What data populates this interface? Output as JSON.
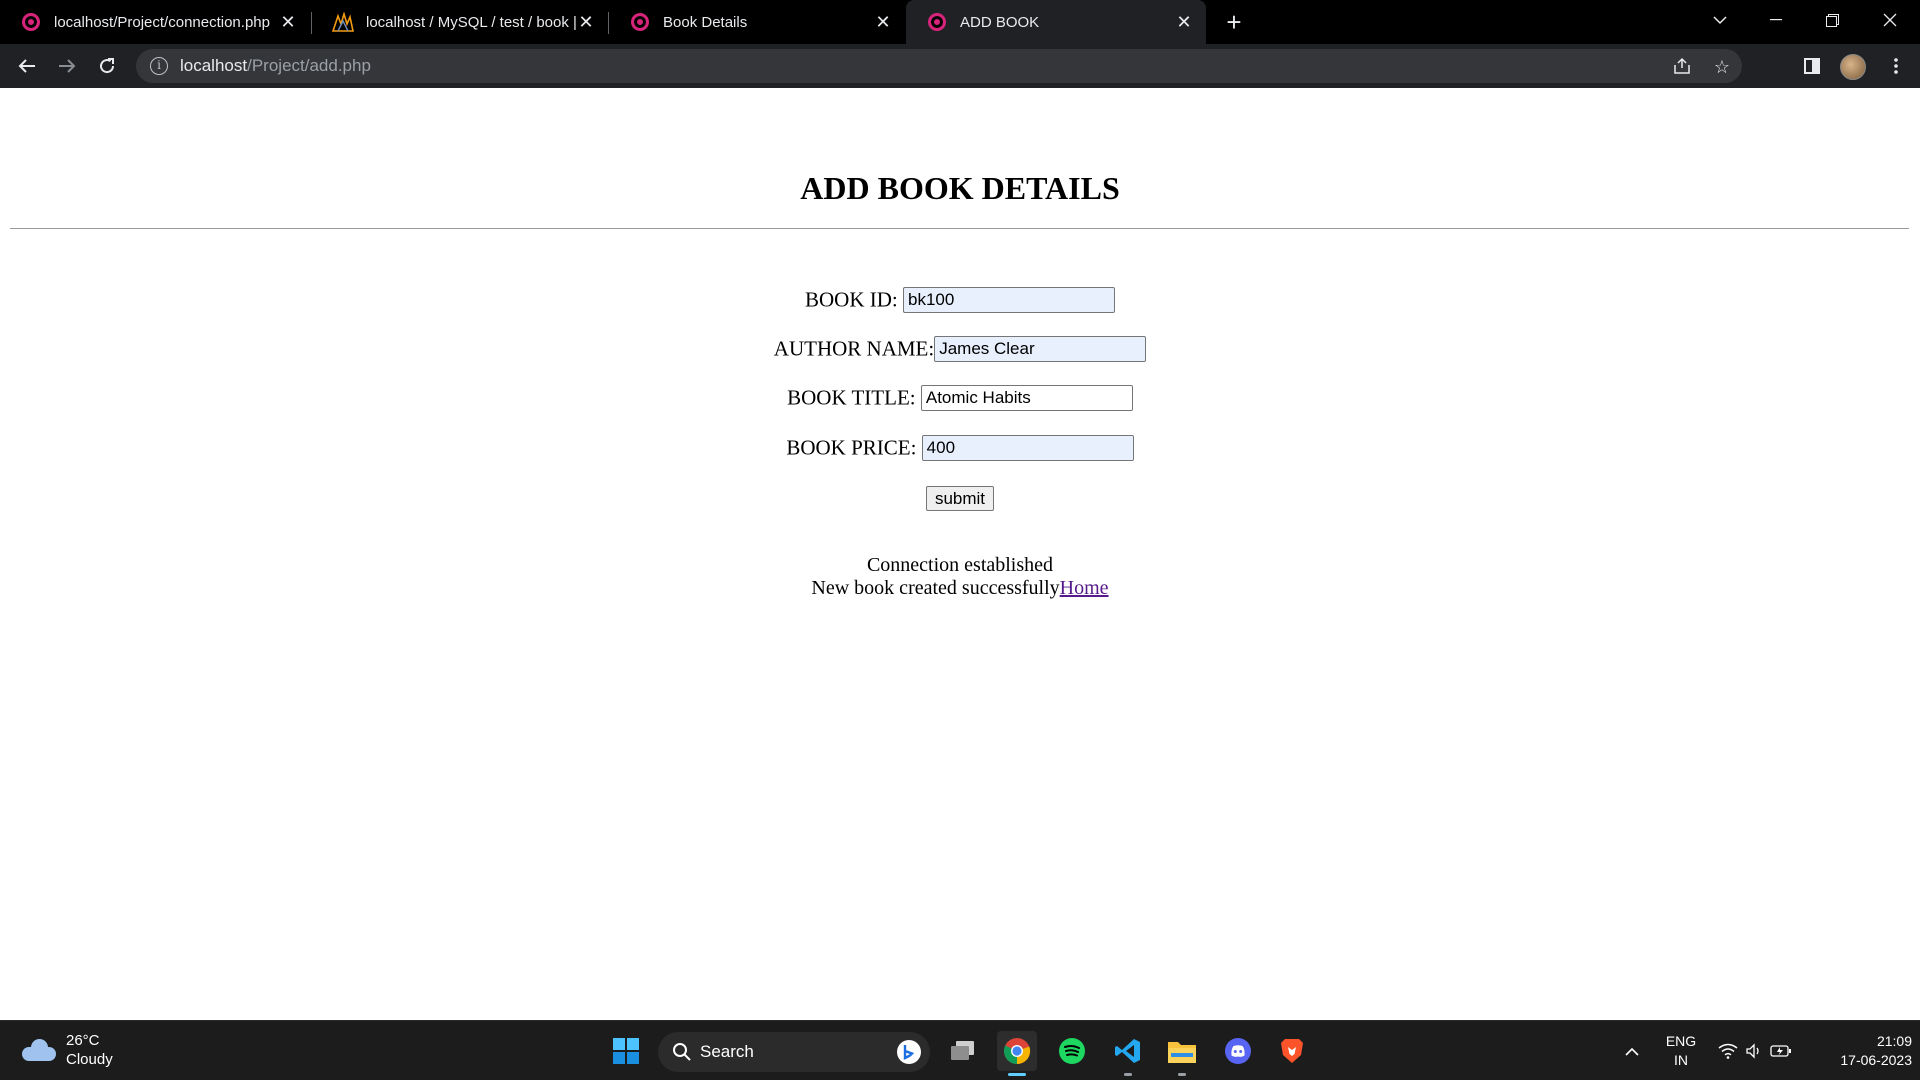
{
  "browser": {
    "tabs": [
      {
        "title": "localhost/Project/connection.php",
        "icon": "wamp-icon",
        "active": false
      },
      {
        "title": "localhost / MySQL / test / book |",
        "icon": "phpmyadmin-icon",
        "active": false
      },
      {
        "title": "Book Details",
        "icon": "wamp-icon",
        "active": false
      },
      {
        "title": "ADD BOOK",
        "icon": "wamp-icon",
        "active": true
      }
    ],
    "address": {
      "host": "localhost",
      "path": "/Project/add.php"
    }
  },
  "page": {
    "heading": "ADD BOOK DETAILS",
    "fields": {
      "book_id": {
        "label": "BOOK ID:",
        "value": "bk100"
      },
      "author_name": {
        "label": "AUTHOR NAME:",
        "value": "James Clear"
      },
      "book_title": {
        "label": "BOOK TITLE:",
        "value": "Atomic Habits"
      },
      "book_price": {
        "label": "BOOK PRICE:",
        "value": "400"
      }
    },
    "submit_label": "submit",
    "messages": {
      "connection": "Connection established",
      "created": "New book created successfully",
      "home_link": "Home"
    }
  },
  "taskbar": {
    "weather": {
      "temp": "26°C",
      "condition": "Cloudy"
    },
    "search_label": "Search",
    "lang": {
      "line1": "ENG",
      "line2": "IN"
    },
    "clock": {
      "time": "21:09",
      "date": "17-06-2023"
    }
  }
}
